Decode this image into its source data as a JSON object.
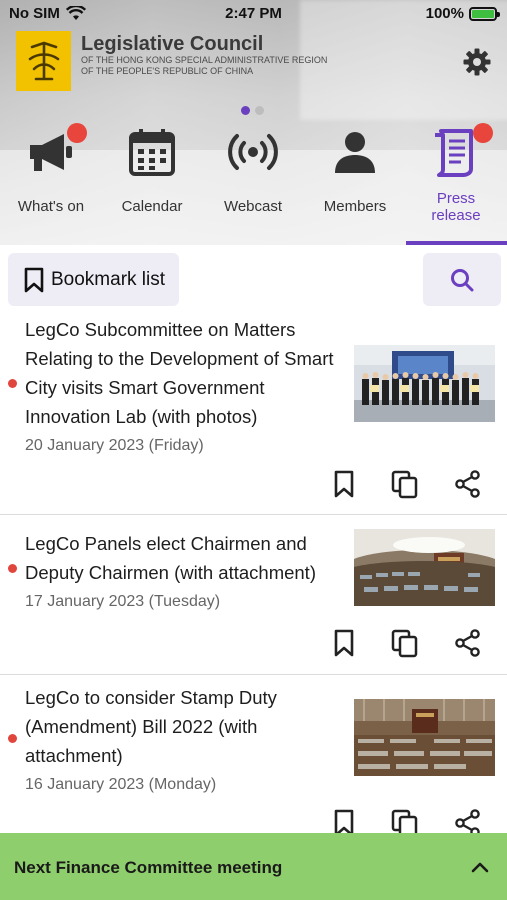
{
  "status_bar": {
    "carrier": "No SIM",
    "time": "2:47 PM",
    "battery": "100%"
  },
  "header": {
    "title": "Legislative Council",
    "subtitle_line1": "OF THE HONG KONG SPECIAL ADMINISTRATIVE REGION",
    "subtitle_line2": "OF THE PEOPLE'S REPUBLIC OF CHINA",
    "logo_icon": "legco-logo",
    "settings_icon": "gear-icon"
  },
  "pager": {
    "pages": 2,
    "current": 1
  },
  "nav": {
    "items": [
      {
        "label": "What's on",
        "icon": "megaphone-icon",
        "badge": true
      },
      {
        "label": "Calendar",
        "icon": "calendar-icon",
        "badge": false
      },
      {
        "label": "Webcast",
        "icon": "broadcast-icon",
        "badge": false
      },
      {
        "label": "Members",
        "icon": "person-icon",
        "badge": false
      },
      {
        "label": "Press\nrelease",
        "icon": "press-release-icon",
        "badge": true,
        "active": true
      }
    ],
    "active_color": "#6a3fc0"
  },
  "toolbar": {
    "bookmark_label": "Bookmark list",
    "search_icon": "search-icon"
  },
  "press_releases": [
    {
      "title": "LegCo Subcommittee on Matters Relating to the Development of Smart City visits Smart Government Innovation Lab (with photos)",
      "date": "20 January 2023 (Friday)",
      "unread": true
    },
    {
      "title": "LegCo Panels elect Chairmen and Deputy Chairmen (with attachment)",
      "date": "17 January 2023 (Tuesday)",
      "unread": true
    },
    {
      "title": "LegCo to consider Stamp Duty (Amendment) Bill 2022 (with attachment)",
      "date": "16 January 2023 (Monday)",
      "unread": true
    }
  ],
  "bottom_banner": {
    "label": "Next Finance Committee meeting",
    "icon": "chevron-up-icon",
    "color": "#8fce6c"
  }
}
